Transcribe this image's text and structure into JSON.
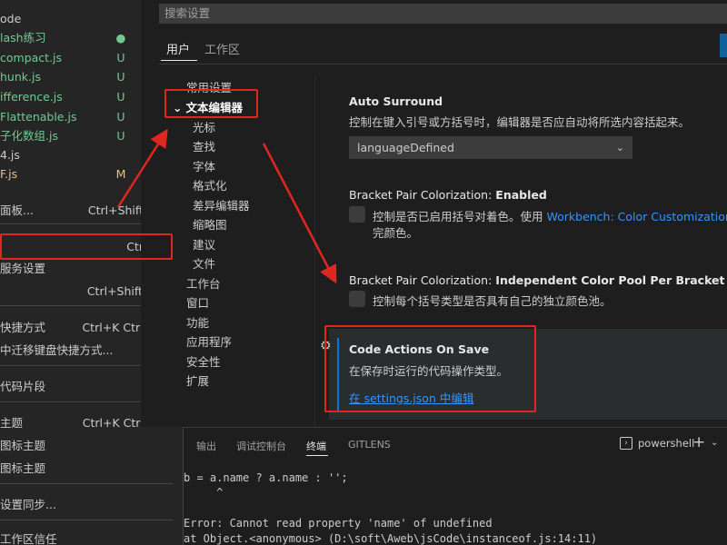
{
  "explorer": {
    "files": [
      {
        "name": "ode",
        "badge": "",
        "color": "white"
      },
      {
        "name": "lash练习",
        "badge": "●",
        "color": "green"
      },
      {
        "name": "compact.js",
        "badge": "U",
        "color": "green"
      },
      {
        "name": "hunk.js",
        "badge": "U",
        "color": "green"
      },
      {
        "name": "ifference.js",
        "badge": "U",
        "color": "green"
      },
      {
        "name": "Flattenable.js",
        "badge": "U",
        "color": "green"
      },
      {
        "name": "子化数组.js",
        "badge": "U",
        "color": "green"
      },
      {
        "name": "4.js",
        "badge": "",
        "color": "white"
      },
      {
        "name": "F.js",
        "badge": "M",
        "color": "mod"
      }
    ]
  },
  "menu": {
    "items": [
      {
        "label": "面板...",
        "shortcut": "Ctrl+Shift+P"
      },
      {
        "label": "",
        "shortcut": "Ctrl+,"
      },
      {
        "label": "服务设置",
        "shortcut": ""
      },
      {
        "label": "",
        "shortcut": "Ctrl+Shift+X"
      },
      {
        "label": "快捷方式",
        "shortcut": "Ctrl+K Ctrl+S"
      },
      {
        "label": "中迁移键盘快捷方式...",
        "shortcut": ""
      },
      {
        "label": "代码片段",
        "shortcut": ""
      },
      {
        "label": "主题",
        "shortcut": "Ctrl+K Ctrl+T"
      },
      {
        "label": "图标主题",
        "shortcut": ""
      },
      {
        "label": "图标主题",
        "shortcut": ""
      },
      {
        "label": "设置同步...",
        "shortcut": ""
      },
      {
        "label": "工作区信任",
        "shortcut": ""
      }
    ]
  },
  "settings": {
    "search_placeholder": "搜索设置",
    "scope_tabs": [
      "用户",
      "工作区"
    ],
    "toc": [
      "常用设置",
      "文本编辑器",
      "光标",
      "查找",
      "字体",
      "格式化",
      "差异编辑器",
      "缩略图",
      "建议",
      "文件",
      "工作台",
      "窗口",
      "功能",
      "应用程序",
      "安全性",
      "扩展"
    ],
    "auto_surround": {
      "title": "Auto Surround",
      "description": "控制在键入引号或方括号时，编辑器是否应自动将所选内容括起来。",
      "value": "languageDefined"
    },
    "bracket_colorization": {
      "title_prefix": "Bracket Pair Colorization: ",
      "title_name": "Enabled",
      "description": "控制是否已启用括号对着色。使用 ",
      "link": "Workbench: Color Customizations",
      "description_tail": "完颜色。"
    },
    "independent_pool": {
      "title_prefix": "Bracket Pair Colorization: ",
      "title_name": "Independent Color Pool Per Bracket Type",
      "description": "控制每个括号类型是否具有自己的独立颜色池。"
    },
    "code_actions": {
      "title": "Code Actions On Save",
      "description": "在保存时运行的代码操作类型。",
      "edit_link": "在 settings.json 中编辑"
    }
  },
  "panel": {
    "tabs": [
      "输出",
      "调试控制台",
      "终端",
      "GITLENS"
    ],
    "active_tab": "终端",
    "terminal_name": "powershell",
    "terminal_lines": [
      "b = a.name ? a.name : '';",
      "     ^",
      "",
      "Error: Cannot read property 'name' of undefined",
      "at Object.<anonymous> (D:\\soft\\Aweb\\jsCode\\instanceof.js:14:11)"
    ]
  },
  "colors": {
    "annotation_red": "#e0261e",
    "link_blue": "#3794ff",
    "git_green": "#73c991",
    "git_modified": "#e2c08d"
  }
}
